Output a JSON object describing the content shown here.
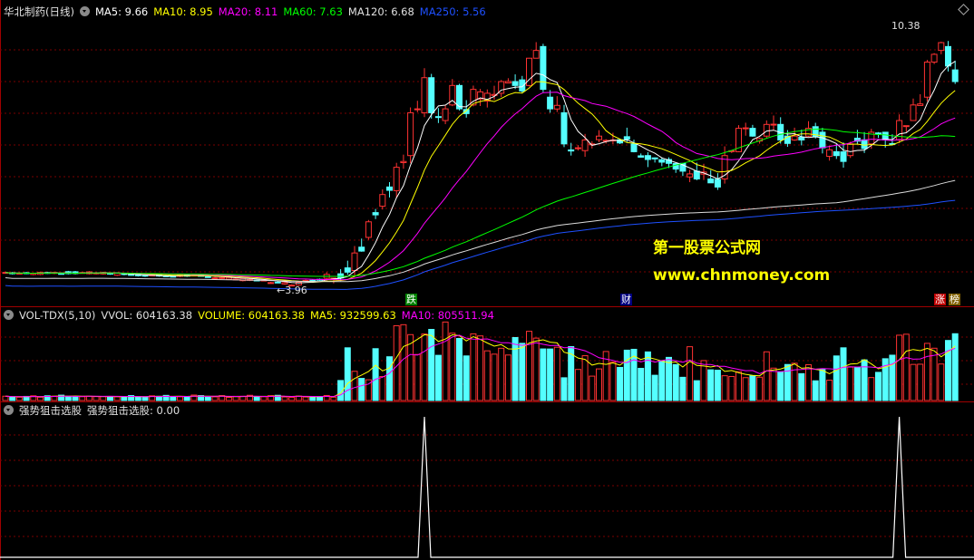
{
  "stock_name": "华北制药(日线)",
  "ma_labels": [
    {
      "text": "MA5: 9.66",
      "color": "#ffffff"
    },
    {
      "text": "MA10: 8.95",
      "color": "#ffff00"
    },
    {
      "text": "MA20: 8.11",
      "color": "#ff00ff"
    },
    {
      "text": "MA60: 7.63",
      "color": "#00ff00"
    },
    {
      "text": "MA120: 6.68",
      "color": "#e0e0e0"
    },
    {
      "text": "MA250: 5.56",
      "color": "#1e50ff"
    }
  ],
  "vol_labels": [
    {
      "text": "VOL-TDX(5,10)",
      "color": "#e0e0e0"
    },
    {
      "text": "VVOL: 604163.38",
      "color": "#e0e0e0"
    },
    {
      "text": "VOLUME: 604163.38",
      "color": "#ffff00"
    },
    {
      "text": "MA5: 932599.63",
      "color": "#ffff00"
    },
    {
      "text": "MA10: 805511.94",
      "color": "#ff00ff"
    }
  ],
  "ind_labels": [
    {
      "text": "强势狙击选股",
      "color": "#e0e0e0"
    },
    {
      "text": "强势狙击选股: 0.00",
      "color": "#e0e0e0"
    }
  ],
  "price_high_label": "10.38",
  "price_low_label": "←3.96",
  "badges": [
    {
      "text": "跌",
      "bg": "#008000",
      "color": "#ffffff"
    },
    {
      "text": "财",
      "bg": "#000080",
      "color": "#ffffff"
    },
    {
      "text": "涨",
      "bg": "#c00000",
      "color": "#ffffff"
    },
    {
      "text": "榜",
      "bg": "#806000",
      "color": "#ffffff"
    }
  ],
  "watermark": {
    "line1": "第一股票公式网",
    "line2": "www.chnmoney.com",
    "color": "#ffff00"
  },
  "colors": {
    "up": "#ff3232",
    "down": "#54ffff",
    "grid": "#7a0000",
    "border": "#a00000"
  },
  "chart_data": {
    "type": "candlestick",
    "ohlc_anchors": [
      [
        0,
        4.3,
        4.3
      ],
      [
        5,
        4.25,
        4.3
      ],
      [
        15,
        4.28,
        4.26
      ],
      [
        25,
        4.2,
        4.24
      ],
      [
        35,
        4.1,
        4.12
      ],
      [
        42,
        3.98,
        4.05
      ],
      [
        46,
        4.15,
        4.25
      ],
      [
        50,
        4.35,
        4.8
      ],
      [
        52,
        5.2,
        5.6
      ],
      [
        54,
        6.0,
        6.3
      ],
      [
        56,
        6.4,
        7.0
      ],
      [
        58,
        7.3,
        8.4
      ],
      [
        59,
        8.5,
        8.5
      ],
      [
        60,
        8.4,
        9.3
      ],
      [
        61,
        9.3,
        8.4
      ],
      [
        63,
        8.2,
        8.5
      ],
      [
        64,
        8.6,
        9.1
      ],
      [
        65,
        9.1,
        8.5
      ],
      [
        67,
        8.6,
        9.0
      ],
      [
        69,
        8.7,
        8.9
      ],
      [
        71,
        8.9,
        9.2
      ],
      [
        73,
        9.2,
        9.1
      ],
      [
        75,
        9.1,
        9.8
      ],
      [
        76,
        9.8,
        10.0
      ],
      [
        77,
        10.1,
        9.0
      ],
      [
        78,
        8.8,
        8.5
      ],
      [
        80,
        8.4,
        7.6
      ],
      [
        82,
        7.5,
        7.5
      ],
      [
        84,
        7.6,
        7.6
      ],
      [
        87,
        7.7,
        7.7
      ],
      [
        90,
        7.6,
        7.4
      ],
      [
        92,
        7.3,
        7.2
      ],
      [
        95,
        7.2,
        7.1
      ],
      [
        97,
        7.1,
        6.9
      ],
      [
        99,
        6.9,
        6.7
      ],
      [
        101,
        6.7,
        6.6
      ],
      [
        103,
        6.7,
        7.3
      ],
      [
        105,
        7.4,
        8.0
      ],
      [
        107,
        8.0,
        7.8
      ],
      [
        109,
        7.8,
        8.1
      ],
      [
        111,
        8.1,
        7.7
      ],
      [
        113,
        7.7,
        7.8
      ],
      [
        115,
        7.8,
        8.0
      ],
      [
        117,
        7.9,
        7.5
      ],
      [
        119,
        7.4,
        7.3
      ],
      [
        121,
        7.3,
        7.6
      ],
      [
        124,
        7.6,
        7.9
      ],
      [
        126,
        7.9,
        7.7
      ],
      [
        128,
        7.7,
        8.2
      ],
      [
        130,
        8.2,
        8.6
      ],
      [
        132,
        8.8,
        9.7
      ],
      [
        133,
        9.7,
        9.9
      ],
      [
        134,
        10.0,
        10.2
      ],
      [
        135,
        10.1,
        9.6
      ],
      [
        136,
        9.5,
        9.2
      ]
    ],
    "ma_series": [
      "MA5",
      "MA10",
      "MA20",
      "MA60",
      "MA120",
      "MA250"
    ],
    "indicator_spikes": [
      60,
      128
    ]
  }
}
